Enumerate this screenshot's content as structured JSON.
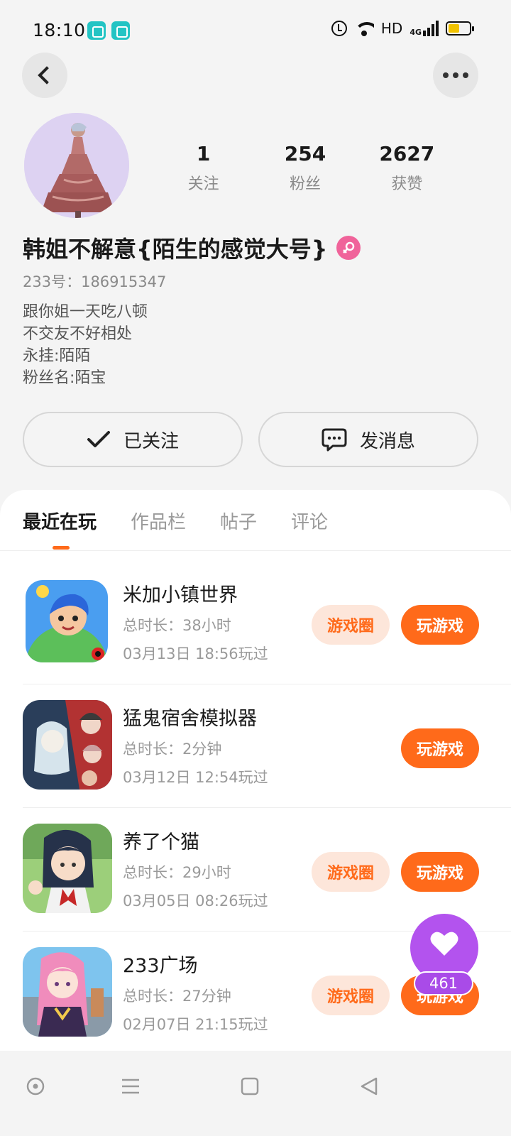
{
  "status_bar": {
    "time": "18:10",
    "network_label": "HD",
    "signal_label": "4G",
    "icons": [
      "app-notification-icon",
      "app-notification-icon",
      "alarm-icon",
      "wifi-icon",
      "signal-icon",
      "battery-icon"
    ],
    "battery_level": 0.55
  },
  "header": {
    "back_icon": "chevron-left-icon",
    "more_icon": "more-horizontal-icon"
  },
  "profile": {
    "stats": [
      {
        "value": "1",
        "label": "关注"
      },
      {
        "value": "254",
        "label": "粉丝"
      },
      {
        "value": "2627",
        "label": "获赞"
      }
    ],
    "nickname": "韩姐不解意{陌生的感觉大号}",
    "gender_icon": "female-icon",
    "uid": "233号：186915347",
    "bio": [
      "跟你姐一天吃八顿",
      "不交友不好相处",
      "永挂:陌陌",
      "粉丝名:陌宝"
    ]
  },
  "actions": {
    "follow_label": "已关注",
    "message_label": "发消息"
  },
  "tabs": [
    "最近在玩",
    "作品栏",
    "帖子",
    "评论"
  ],
  "games": [
    {
      "title": "米加小镇世界",
      "duration": "总时长：38小时",
      "last_played": "03月13日 18:56玩过",
      "circle_label": "游戏圈",
      "play_label": "玩游戏",
      "has_circle": true
    },
    {
      "title": "猛鬼宿舍模拟器",
      "duration": "总时长：2分钟",
      "last_played": "03月12日 12:54玩过",
      "circle_label": "",
      "play_label": "玩游戏",
      "has_circle": false
    },
    {
      "title": "养了个猫",
      "duration": "总时长：29小时",
      "last_played": "03月05日 08:26玩过",
      "circle_label": "游戏圈",
      "play_label": "玩游戏",
      "has_circle": true
    },
    {
      "title": "233广场",
      "duration": "总时长：27分钟",
      "last_played": "02月07日 21:15玩过",
      "circle_label": "游戏圈",
      "play_label": "玩游戏",
      "has_circle": true
    }
  ],
  "like_fab": {
    "count": "461",
    "icon": "heart-icon"
  },
  "colors": {
    "accent": "#ff6a1a",
    "accent_soft": "#fde6da",
    "fab": "#b353ee",
    "gender": "#f0639a"
  }
}
